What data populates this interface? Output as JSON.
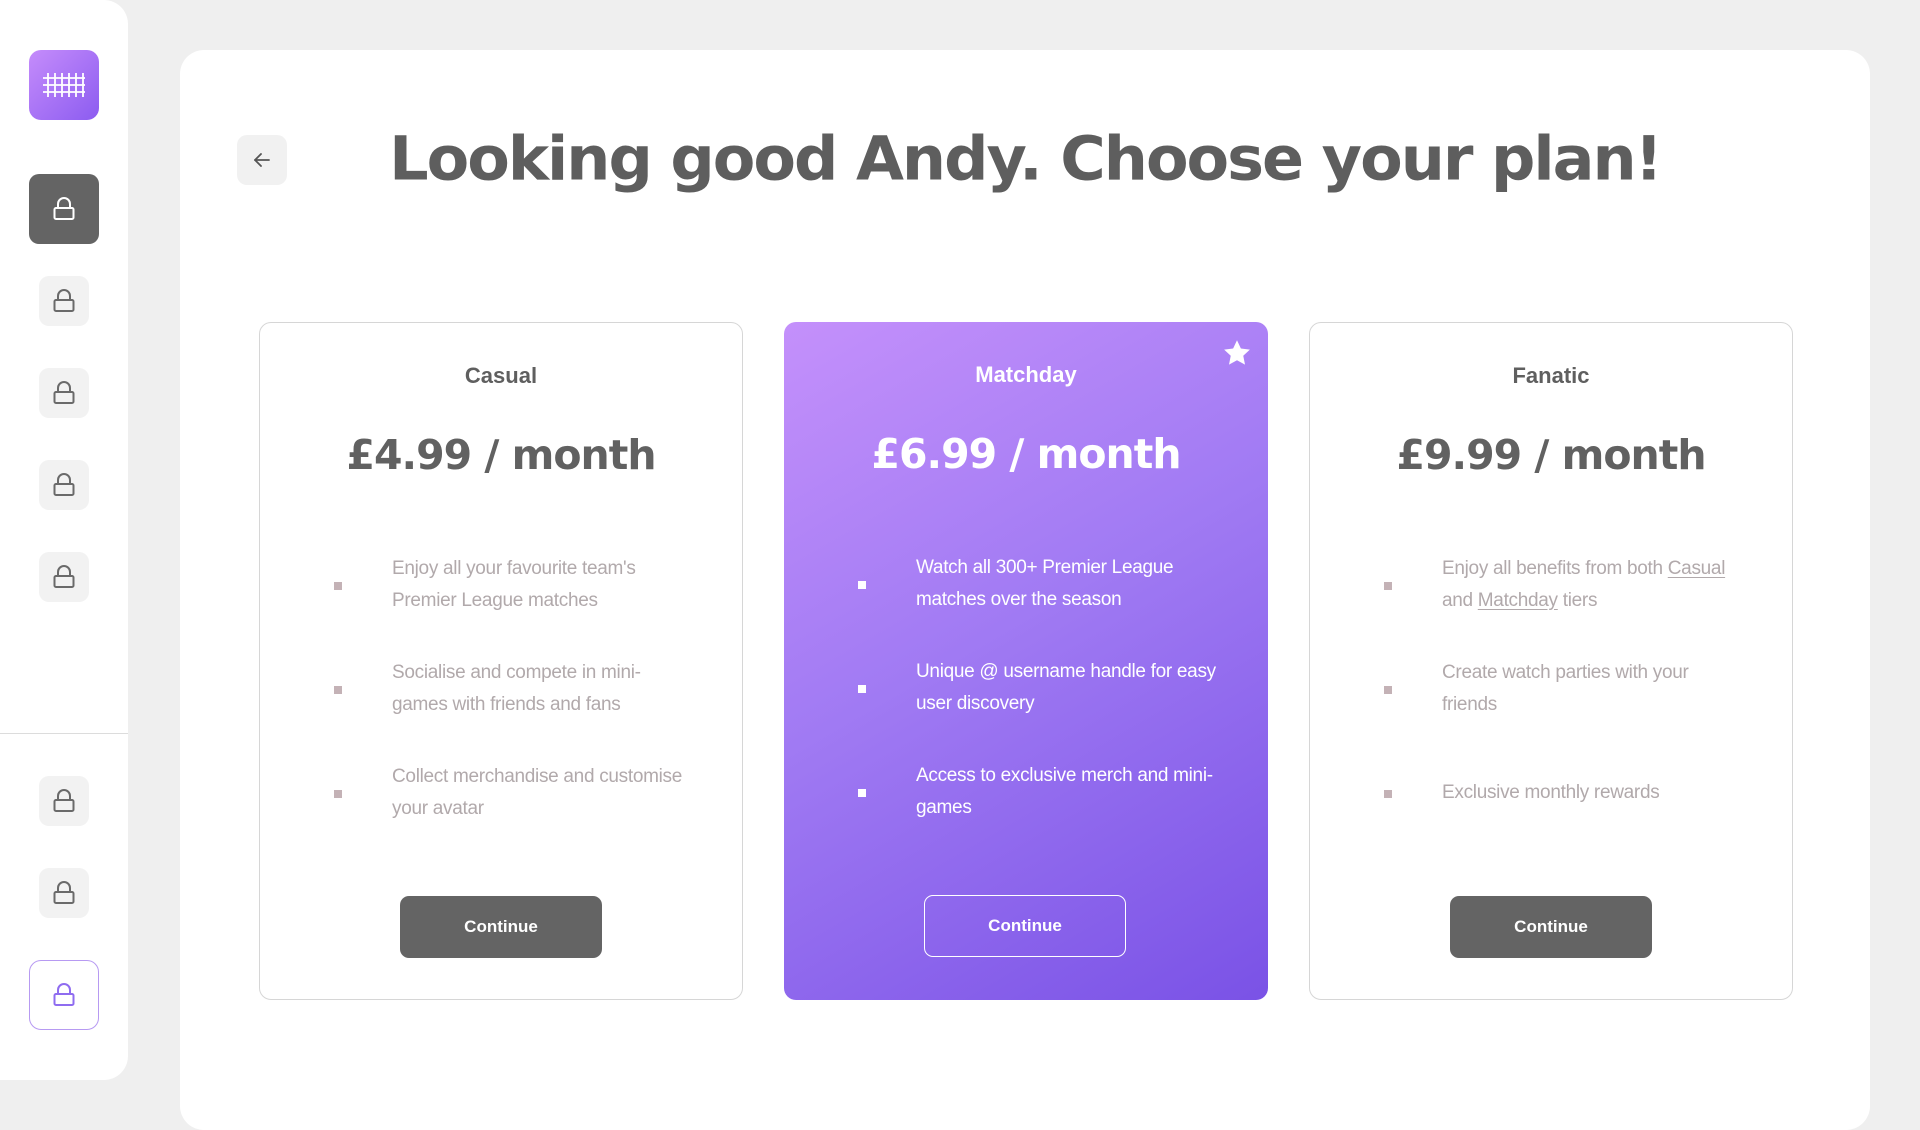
{
  "header": {
    "title": "Looking good Andy. Choose your plan!"
  },
  "sidebar": {
    "logo_icon": "grid-icon",
    "items": [
      {
        "icon": "lock-icon",
        "state": "active"
      },
      {
        "icon": "lock-icon",
        "state": "locked"
      },
      {
        "icon": "lock-icon",
        "state": "locked"
      },
      {
        "icon": "lock-icon",
        "state": "locked"
      },
      {
        "icon": "lock-icon",
        "state": "locked"
      }
    ],
    "bottom_items": [
      {
        "icon": "lock-icon",
        "state": "locked"
      },
      {
        "icon": "lock-icon",
        "state": "locked"
      },
      {
        "icon": "lock-icon",
        "state": "selected"
      }
    ]
  },
  "plans": [
    {
      "name": "Casual",
      "price": "£4.99 / month",
      "features": [
        "Enjoy all your favourite team's Premier League matches",
        "Socialise and compete in mini-games with friends and fans",
        "Collect merchandise and customise your avatar"
      ],
      "cta": "Continue"
    },
    {
      "name": "Matchday",
      "price": "£6.99 / month",
      "featured_icon": "star-icon",
      "features": [
        "Watch all 300+ Premier League matches over the season",
        "Unique @ username handle for easy user discovery",
        "Access to exclusive merch and mini-games"
      ],
      "cta": "Continue"
    },
    {
      "name": "Fanatic",
      "price": "£9.99 / month",
      "features": [
        {
          "before": "Enjoy all benefits from both ",
          "link1": "Casual",
          "middle": " and ",
          "link2": "Matchday",
          "after": " tiers"
        },
        "Create watch parties with your friends",
        "Exclusive monthly rewards"
      ],
      "cta": "Continue"
    }
  ],
  "colors": {
    "accent_start": "#c490fb",
    "accent_end": "#7a52e6",
    "dark_button": "#646464",
    "page_bg": "#efefef"
  }
}
